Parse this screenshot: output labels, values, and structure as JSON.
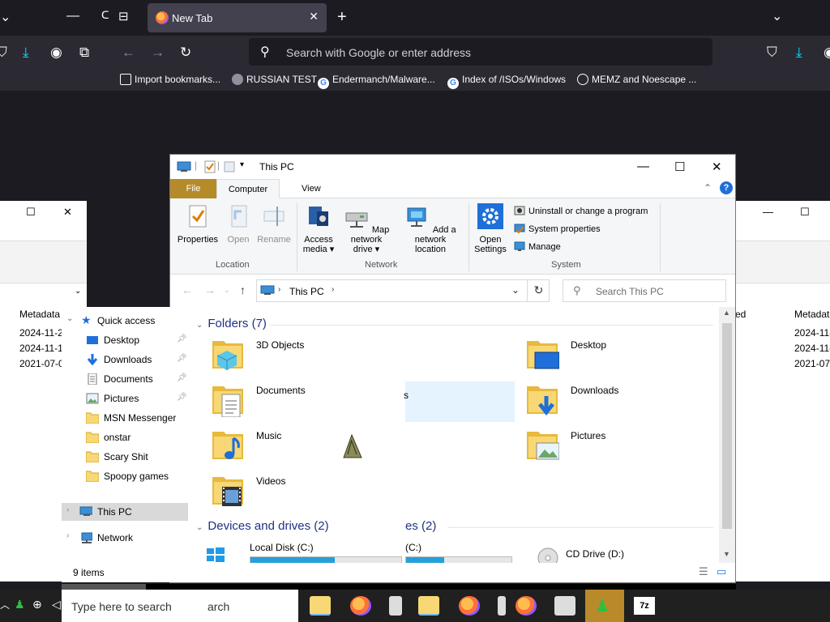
{
  "firefox": {
    "tab": {
      "title": "New Tab"
    },
    "urlbar": {
      "placeholder": "Search with Google or enter address"
    },
    "bookmarks": [
      {
        "icon": "import-icon",
        "label": "Import bookmarks..."
      },
      {
        "icon": "skull-icon",
        "label": "RUSSIAN TEST"
      },
      {
        "icon": "google-icon",
        "label": "Endermanch/Malware..."
      },
      {
        "icon": "google-icon",
        "label": "Index of /ISOs/Windows"
      },
      {
        "icon": "globe-icon",
        "label": "MEMZ and Noescape ..."
      }
    ]
  },
  "explorer": {
    "title": "This PC",
    "ribbon": {
      "tabs": {
        "file": "File",
        "computer": "Computer",
        "view": "View"
      },
      "location": {
        "group": "Location",
        "properties": "Properties",
        "open": "Open",
        "rename": "Rename"
      },
      "network": {
        "group": "Network",
        "access_media_1": "Access",
        "access_media_2": "media ▾",
        "map_drive_1": "Map network",
        "map_drive_2": "drive ▾",
        "add_location_1": "Add a network",
        "add_location_2": "location"
      },
      "system": {
        "group": "System",
        "open_settings_1": "Open",
        "open_settings_2": "Settings",
        "uninstall": "Uninstall or change a program",
        "system_properties": "System properties",
        "manage": "Manage"
      }
    },
    "address": {
      "crumb": "This PC",
      "search_placeholder": "Search This PC"
    },
    "nav": {
      "quick_access": "Quick access",
      "items": [
        "Desktop",
        "Downloads",
        "Documents",
        "Pictures",
        "MSN Messenger",
        "onstar",
        "Scary Shit",
        "Spoopy games"
      ],
      "this_pc": "This PC",
      "network": "Network"
    },
    "sections": {
      "folders": "Folders (7)",
      "devices": "Devices and drives (2)"
    },
    "folders": {
      "objects3d": "3D Objects",
      "desktop": "Desktop",
      "documents": "Documents",
      "downloads": "Downloads",
      "music": "Music",
      "pictures": "Pictures",
      "videos": "Videos"
    },
    "ghost": {
      "folder_suffix": "s",
      "devices_suffix": "es (2)",
      "drive_suffix": "(C:)"
    },
    "drives": {
      "local": {
        "label": "Local Disk (C:)",
        "used_fraction": 0.56
      },
      "cd": {
        "label": "CD Drive (D:)"
      }
    },
    "status": {
      "items": "9 items"
    }
  },
  "background_windows": {
    "left": {
      "col_header": "Metadata",
      "rows": [
        "2024-11-2",
        "2024-11-1",
        "2021-07-0"
      ]
    },
    "right": {
      "col_fragment": "ed",
      "col_header": "Metadat",
      "rows": [
        "2024-11-",
        "2024-11-",
        "2021-07-"
      ]
    }
  },
  "taskbar": {
    "search_placeholder": "Type here to search",
    "search_overlap": "arch"
  }
}
